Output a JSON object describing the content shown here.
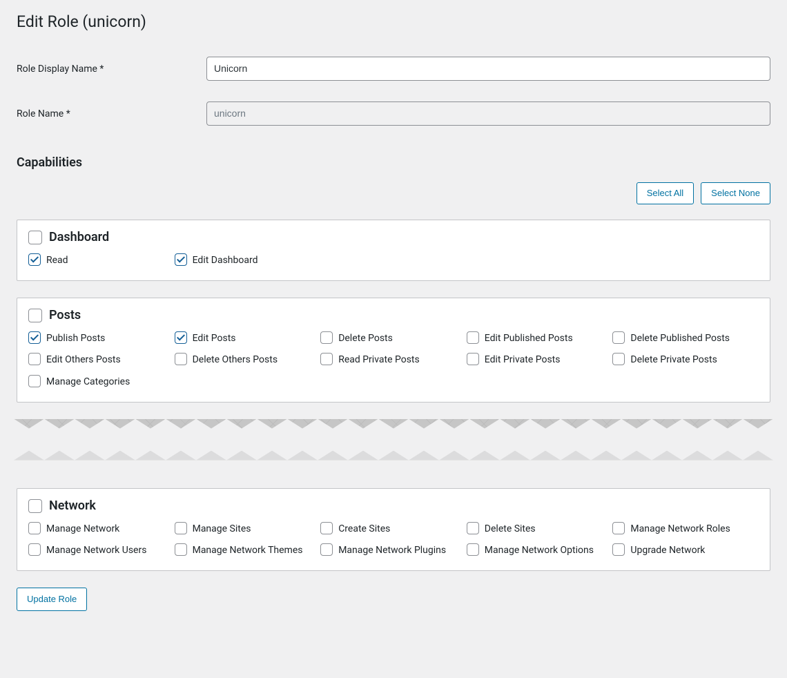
{
  "page_title": "Edit Role (unicorn)",
  "form": {
    "display_name_label": "Role Display Name *",
    "display_name_value": "Unicorn",
    "role_name_label": "Role Name *",
    "role_name_value": "unicorn"
  },
  "capabilities_heading": "Capabilities",
  "buttons": {
    "select_all": "Select All",
    "select_none": "Select None",
    "update_role": "Update Role"
  },
  "groups": [
    {
      "name": "Dashboard",
      "items": [
        {
          "label": "Read",
          "checked": true
        },
        {
          "label": "Edit Dashboard",
          "checked": true
        }
      ]
    },
    {
      "name": "Posts",
      "items": [
        {
          "label": "Publish Posts",
          "checked": true
        },
        {
          "label": "Edit Posts",
          "checked": true
        },
        {
          "label": "Delete Posts",
          "checked": false
        },
        {
          "label": "Edit Published Posts",
          "checked": false
        },
        {
          "label": "Delete Published Posts",
          "checked": false
        },
        {
          "label": "Edit Others Posts",
          "checked": false
        },
        {
          "label": "Delete Others Posts",
          "checked": false
        },
        {
          "label": "Read Private Posts",
          "checked": false
        },
        {
          "label": "Edit Private Posts",
          "checked": false
        },
        {
          "label": "Delete Private Posts",
          "checked": false
        },
        {
          "label": "Manage Categories",
          "checked": false
        }
      ]
    },
    {
      "name": "Network",
      "items": [
        {
          "label": "Manage Network",
          "checked": false
        },
        {
          "label": "Manage Sites",
          "checked": false
        },
        {
          "label": "Create Sites",
          "checked": false
        },
        {
          "label": "Delete Sites",
          "checked": false
        },
        {
          "label": "Manage Network Roles",
          "checked": false
        },
        {
          "label": "Manage Network Users",
          "checked": false
        },
        {
          "label": "Manage Network Themes",
          "checked": false
        },
        {
          "label": "Manage Network Plugins",
          "checked": false
        },
        {
          "label": "Manage Network Options",
          "checked": false
        },
        {
          "label": "Upgrade Network",
          "checked": false
        }
      ]
    }
  ]
}
